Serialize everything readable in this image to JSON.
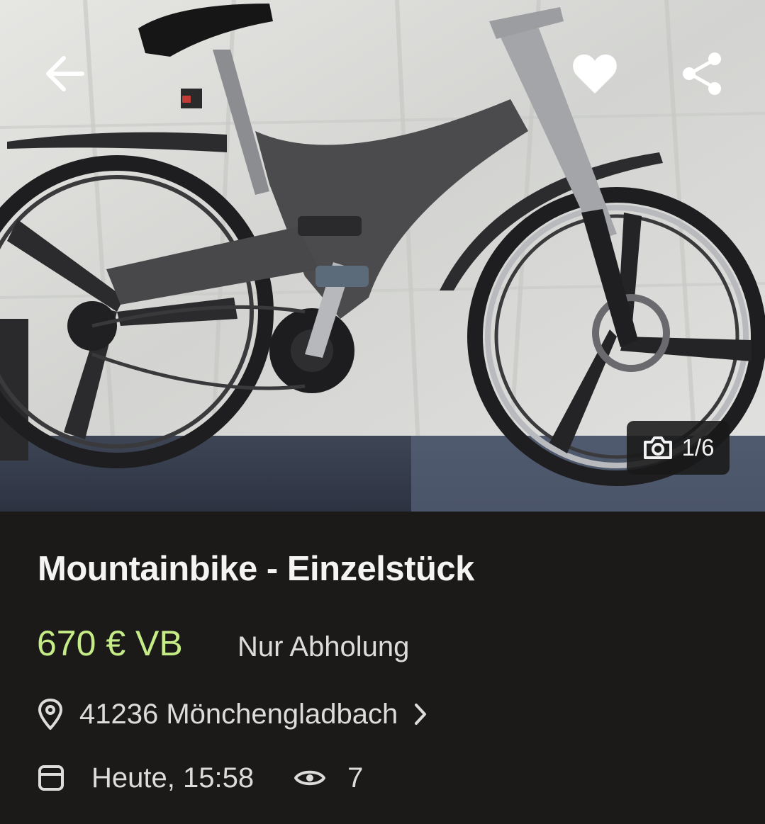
{
  "gallery": {
    "image_alt": "Mountainbike",
    "counter": "1/6",
    "actions": {
      "back_icon": "arrow-left-icon",
      "favorite_icon": "heart-icon",
      "share_icon": "share-icon"
    }
  },
  "listing": {
    "title": "Mountainbike - Einzelstück",
    "price": "670 € VB",
    "shipping": "Nur Abholung",
    "location": "41236 Mönchengladbach",
    "date": "Heute, 15:58",
    "views": "7"
  },
  "colors": {
    "price": "#c5ec86",
    "background": "#1b1a19",
    "text": "#dcdcda"
  }
}
